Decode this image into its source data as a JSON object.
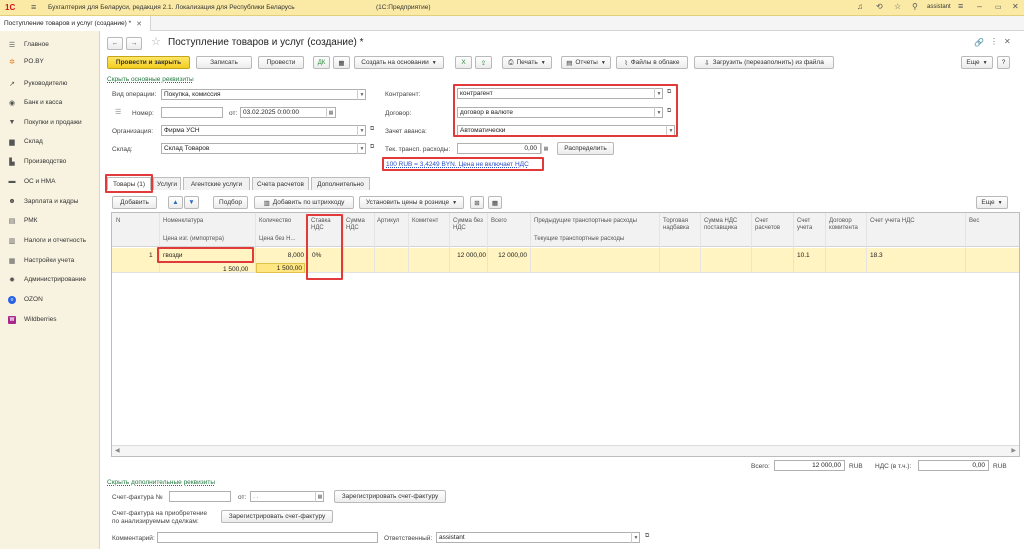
{
  "app": {
    "title": "Бухгалтерия для Беларуси, редакция 2.1. Локализация для Республики Беларусь",
    "platform": "(1С:Предприятие)",
    "user": "assistant",
    "logo": "1С"
  },
  "window_tab": {
    "label": "Поступление товаров и услуг (создание) *"
  },
  "sidebar": {
    "items": [
      {
        "label": "Главное",
        "icon": "menu-icon"
      },
      {
        "label": "PO.BY",
        "icon": "star-icon"
      },
      {
        "label": "Руководителю",
        "icon": "chart-icon"
      },
      {
        "label": "Банк и касса",
        "icon": "bank-icon"
      },
      {
        "label": "Покупки и продажи",
        "icon": "cart-icon"
      },
      {
        "label": "Склад",
        "icon": "box-icon"
      },
      {
        "label": "Производство",
        "icon": "factory-icon"
      },
      {
        "label": "ОС и НМА",
        "icon": "truck-icon"
      },
      {
        "label": "Зарплата и кадры",
        "icon": "people-icon"
      },
      {
        "label": "РМК",
        "icon": "register-icon"
      },
      {
        "label": "Налоги и отчетность",
        "icon": "report-icon"
      },
      {
        "label": "Настройки учета",
        "icon": "settings-icon"
      },
      {
        "label": "Администрирование",
        "icon": "gear-icon"
      },
      {
        "label": "OZON",
        "icon": "ozon-icon"
      },
      {
        "label": "Wildberries",
        "icon": "wb-icon"
      }
    ]
  },
  "doc": {
    "title": "Поступление товаров и услуг (создание) *"
  },
  "toolbar": {
    "post_close": "Провести и закрыть",
    "save": "Записать",
    "post": "Провести",
    "create_based": "Создать на основании",
    "print": "Печать",
    "reports": "Отчеты",
    "cloud_files": "Файлы в облаке",
    "load_file": "Загрузить (перезаполнить) из файла",
    "more": "Еще"
  },
  "header": {
    "hide_main": "Скрыть основные реквизиты",
    "op_type_label": "Вид операции:",
    "op_type": "Покупка, комиссия",
    "number_label": "Номер:",
    "number": "",
    "date_label": "от:",
    "date": "03.02.2025  0:00:00",
    "org_label": "Организация:",
    "org": "Фирма УСН",
    "warehouse_label": "Склад:",
    "warehouse": "Склад Товаров",
    "contractor_label": "Контрагент:",
    "contractor": "контрагент",
    "contract_label": "Договор:",
    "contract": "договор в валюте",
    "advance_label": "Зачет аванса:",
    "advance": "Автоматически",
    "transport_label": "Тек. трансп. расходы:",
    "transport": "0,00",
    "distribute": "Распределить",
    "rate_link": "100 RUB = 3,4249 BYN. Цена не включает НДС"
  },
  "tabs": [
    "Товары (1)",
    "Услуги",
    "Агентские услуги",
    "Счета расчетов",
    "Дополнительно"
  ],
  "table_toolbar": {
    "add": "Добавить",
    "select": "Подбор",
    "barcode": "Добавить по штрихкоду",
    "set_prices": "Установить цены в рознице",
    "more": "Еще"
  },
  "columns": {
    "n": "N",
    "nom": "Номенклатура",
    "nom2": "Цена изг. (импортера)",
    "qty": "Количество",
    "qty2": "Цена без Н...",
    "vat_rate": "Ставка НДС",
    "vat_sum": "Сумма НДС",
    "article": "Артикул",
    "committent": "Комитент",
    "sum_no_vat": "Сумма без НДС",
    "total": "Всего",
    "prev_transport": "Предыдущие транспортные расходы",
    "cur_transport": "Текущие транспортные расходы",
    "markup": "Торговая надбавка",
    "vat_supplier": "Сумма НДС поставщика",
    "accounts": "Счет расчетов",
    "account": "Счет учета",
    "committent_contract": "Договор комитента",
    "vat_account": "Счет учета НДС",
    "weight": "Вес"
  },
  "row": {
    "n": "1",
    "nom": "гвозди",
    "mfr_price": "1 500,00",
    "qty": "8,000",
    "price": "1 500,00",
    "vat_rate": "0%",
    "sum_no_vat": "12 000,00",
    "total": "12 000,00",
    "account": "10.1",
    "vat_account": "18.3"
  },
  "totals": {
    "total_label": "Всего:",
    "total": "12 000,00",
    "cur": "RUB",
    "vat_label": "НДС (в т.ч.):",
    "vat": "0,00",
    "cur2": "RUB"
  },
  "footer": {
    "show_extra": "Скрыть дополнительные реквизиты",
    "invoice_label": "Счет-фактура №",
    "invoice_no": "",
    "invoice_date_label": "от:",
    "invoice_date": ".  .",
    "reg_invoice": "Зарегистрировать счет-фактуру",
    "invoice_purchase_label": "Счет-фактура на приобретение по анализируемым сделкам:",
    "reg_invoice2": "Зарегистрировать счет-фактуру",
    "comment_label": "Комментарий:",
    "comment": "",
    "responsible_label": "Ответственный:",
    "responsible": "assistant"
  }
}
